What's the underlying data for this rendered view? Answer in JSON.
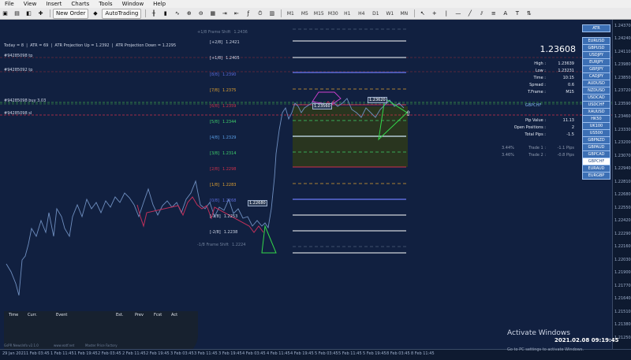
{
  "menu": [
    "File",
    "View",
    "Insert",
    "Charts",
    "Tools",
    "Window",
    "Help"
  ],
  "toolbar": {
    "new_order": "New Order",
    "autotrading": "AutoTrading",
    "timeframes": [
      "M1",
      "M5",
      "M15",
      "M30",
      "H1",
      "H4",
      "D1",
      "W1",
      "MN"
    ]
  },
  "header_info": {
    "today": "Today = 8",
    "atr": "ATR = 69",
    "proj_up": "ATR Projection Up = 1.2392",
    "proj_down": "ATR Projection Down = 1.2295"
  },
  "trade_tags": {
    "tp1": "#94285098 tp",
    "tp2": "#94285092 tp",
    "buy": "#94285098 buy 3.03",
    "sl": "#94285098 sl"
  },
  "levels": [
    {
      "key": "+1/8 Frame Shift",
      "price": "1.2436",
      "color": "#6f7f99"
    },
    {
      "key": "[+2/8]",
      "price": "1.2421",
      "color": "#ffffff"
    },
    {
      "key": "[+1/8]",
      "price": "1.2405",
      "color": "#ffffff"
    },
    {
      "key": "[8/8]",
      "price": "1.2390",
      "color": "#5c6bd8"
    },
    {
      "key": "[7/8]",
      "price": "1.2375",
      "color": "#e0a030"
    },
    {
      "key": "[6/8]",
      "price": "1.2359",
      "color": "#d0304a"
    },
    {
      "key": "[5/8]",
      "price": "1.2344",
      "color": "#3fcf6b"
    },
    {
      "key": "[4/8]",
      "price": "1.2329",
      "color": "#5aa0e8"
    },
    {
      "key": "[3/8]",
      "price": "1.2314",
      "color": "#3fcf6b"
    },
    {
      "key": "[2/8]",
      "price": "1.2298",
      "color": "#d0304a"
    },
    {
      "key": "[1/8]",
      "price": "1.2283",
      "color": "#e0a030"
    },
    {
      "key": "[0/8]",
      "price": "1.2268",
      "color": "#5c6bd8"
    },
    {
      "key": "[-1/8]",
      "price": "1.2253",
      "color": "#ffffff"
    },
    {
      "key": "[-2/8]",
      "price": "1.2238",
      "color": "#ffffff"
    },
    {
      "key": "-1/8 Frame Shift",
      "price": "1.2224",
      "color": "#6f7f99"
    }
  ],
  "price_labels": {
    "marker1": "1.22680",
    "marker2": "1.23560",
    "marker3": "1.23620"
  },
  "panel": {
    "price": "1.23608",
    "high_label": "High :",
    "high": "1.23639",
    "low_label": "Low :",
    "low": "1.23231",
    "time_label": "Time :",
    "time": "10:15",
    "spread_label": "Spread :",
    "spread": "0.6",
    "tf_label": "T.Frame :",
    "tf": "M15",
    "symbol": "GBPCHF",
    "pip_label": "Pip Value :",
    "pip": "11.13",
    "pos_label": "Open Positions :",
    "pos": "2",
    "total_label": "Total Pips :",
    "total": "-1.5",
    "trade1_pct": "3.44%",
    "trade1_label": "Trade 1 :",
    "trade1": "-1.1 Pips",
    "trade2_pct": "3.46%",
    "trade2_label": "Trade 2 :",
    "trade2": "-0.8 Pips"
  },
  "symbols": [
    "ATR",
    "EURUSD",
    "GBPUSD",
    "USDJPY",
    "EURJPY",
    "GBPJPY",
    "CADJPY",
    "AUDUSD",
    "NZDUSD",
    "USDCAD",
    "USDCHF",
    "XAUUSD",
    "HK50",
    "UK100",
    "US500",
    "GBPNZD",
    "GBPAUD",
    "GBPCAD",
    "GBPCHF",
    "EURAUD",
    "EURGBP"
  ],
  "selected_symbol": "GBPCHF",
  "price_axis": [
    "1.24370",
    "1.24240",
    "1.24110",
    "1.23980",
    "1.23850",
    "1.23720",
    "1.23590",
    "1.23460",
    "1.23330",
    "1.23200",
    "1.23070",
    "1.22940",
    "1.22810",
    "1.22680",
    "1.22550",
    "1.22420",
    "1.22290",
    "1.22160",
    "1.22030",
    "1.21900",
    "1.21770",
    "1.21640",
    "1.21510",
    "1.21380",
    "1.21250"
  ],
  "time_axis": [
    "29 Jan 2021",
    "1 Feb 03:45",
    "1 Feb 11:45",
    "1 Feb 19:45",
    "2 Feb 03:45",
    "2 Feb 11:45",
    "2 Feb 19:45",
    "3 Feb 03:45",
    "3 Feb 11:45",
    "3 Feb 19:45",
    "4 Feb 03:45",
    "4 Feb 11:45",
    "4 Feb 19:45",
    "5 Feb 03:45",
    "5 Feb 11:45",
    "5 Feb 19:45",
    "8 Feb 03:45",
    "8 Feb 11:45"
  ],
  "calendar": {
    "time": "Time",
    "curr": "Curr.",
    "event": "Event",
    "est": "Est.",
    "prev": "Prev",
    "fcst": "Fcst",
    "act": "Act"
  },
  "footer": {
    "left": "GsPR NewsInfo v2.1.0",
    "mid": "www.eatf.net",
    "right": "Master Price Factory"
  },
  "activation": {
    "title": "Activate Windows",
    "sub": "Go to PC settings to activate Windows."
  },
  "clock": "2021.02.08 09:19:45"
}
